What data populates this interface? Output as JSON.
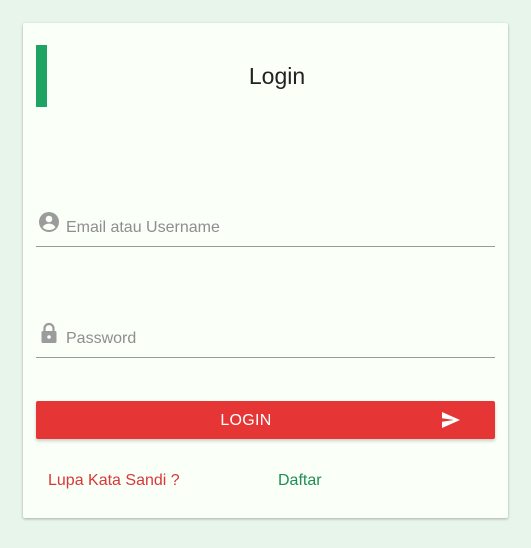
{
  "login_card": {
    "title": "Login",
    "email_field": {
      "placeholder": "Email atau Username",
      "value": "",
      "icon": "account-circle-icon"
    },
    "password_field": {
      "placeholder": "Password",
      "value": "",
      "icon": "lock-icon"
    },
    "login_button": {
      "label": "LOGIN",
      "icon": "send-icon"
    },
    "forgot_password_link": "Lupa Kata Sandi ?",
    "register_link": "Daftar"
  },
  "colors": {
    "background": "#e8f5ea",
    "card": "#fafff8",
    "accent_bar": "#1fa363",
    "login_button": "#e53535",
    "forgot_link": "#d93838",
    "register_link": "#1f8e55"
  }
}
